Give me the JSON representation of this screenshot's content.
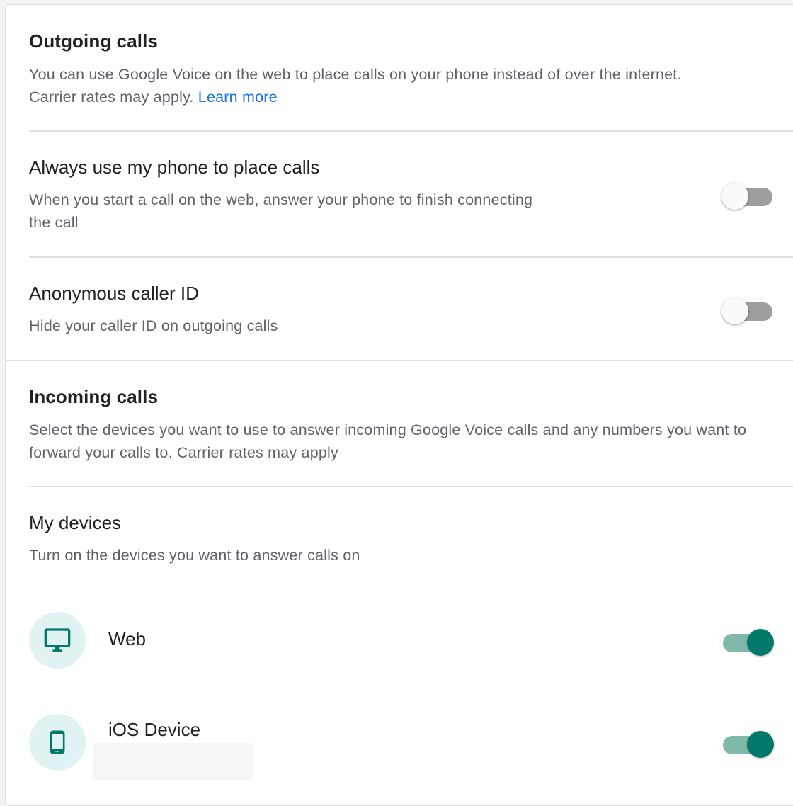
{
  "outgoing": {
    "title": "Outgoing calls",
    "desc_text": "You can use Google Voice on the web to place calls on your phone instead of over the internet. Carrier rates may apply.",
    "learn_more": "Learn more",
    "always_phone": {
      "title": "Always use my phone to place calls",
      "desc": "When you start a call on the web, answer your phone to finish connecting the call",
      "enabled": false
    },
    "anonymous": {
      "title": "Anonymous caller ID",
      "desc": "Hide your caller ID on outgoing calls",
      "enabled": false
    }
  },
  "incoming": {
    "title": "Incoming calls",
    "desc": "Select the devices you want to use to answer incoming Google Voice calls and any numbers you want to forward your calls to. Carrier rates may apply",
    "my_devices": {
      "title": "My devices",
      "desc": "Turn on the devices you want to answer calls on",
      "devices": [
        {
          "label": "Web",
          "icon": "desktop-monitor-icon",
          "enabled": true
        },
        {
          "label": "iOS Device",
          "icon": "smartphone-icon",
          "enabled": true
        }
      ]
    }
  },
  "colors": {
    "accent": "#00796b",
    "accent_track": "#80b9ab",
    "link": "#1a73e8",
    "icon_bg": "#e0f2f1"
  }
}
